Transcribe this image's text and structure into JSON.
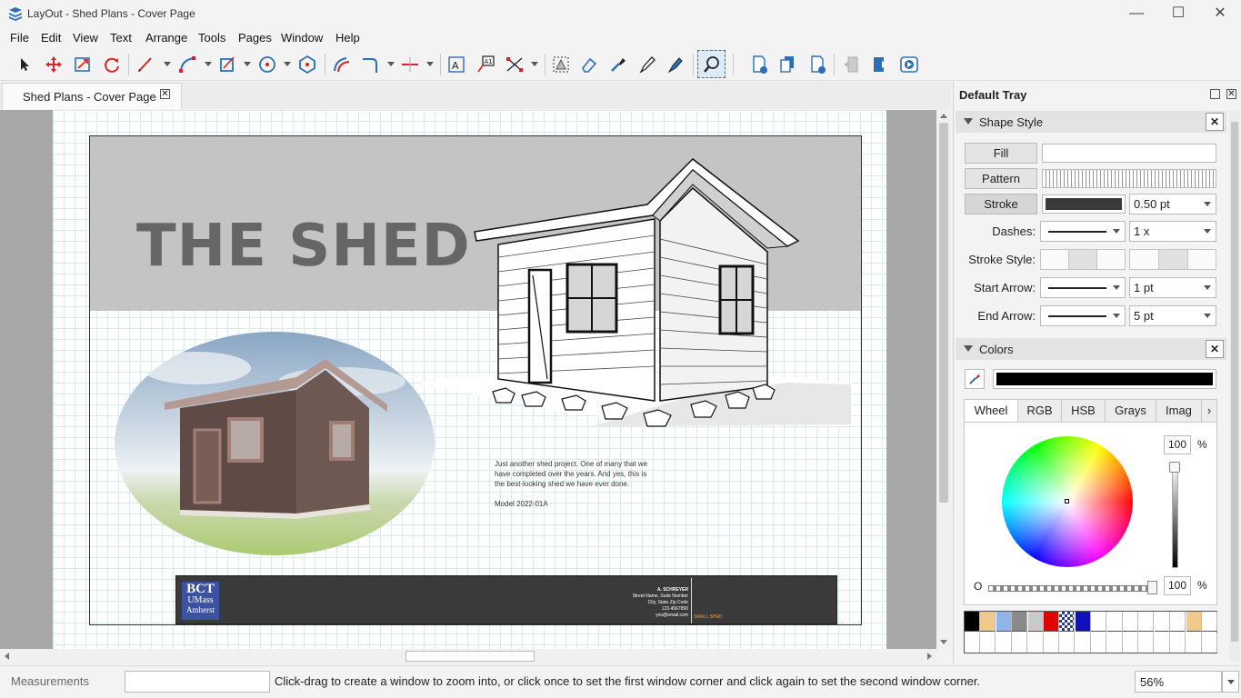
{
  "window": {
    "title": "LayOut - Shed Plans - Cover Page",
    "minimize": "—",
    "maximize": "☐",
    "close": "✕"
  },
  "menu": [
    "File",
    "Edit",
    "View",
    "Text",
    "Arrange",
    "Tools",
    "Pages",
    "Window",
    "Help"
  ],
  "doc_tab": {
    "label": "Shed Plans - Cover Page",
    "close": "✕"
  },
  "page": {
    "title": "THE SHED",
    "description_line1": "Just another shed project. One of many that we",
    "description_line2": "have completed over the years. And yes, this is",
    "description_line3": "the best-looking shed we have ever done.",
    "model": "Model 2022-01A",
    "titleblock": {
      "logo_top": "BCT",
      "logo_mid": "UMass",
      "logo_bot": "Amherst",
      "name": "A. SCHREYER",
      "line1": "Street Name, Suite Number",
      "line2": "City, State Zip Code",
      "line3": "123.4567890",
      "line4": "you@email.com",
      "project": "SMALL SHED"
    }
  },
  "tray": {
    "title": "Default Tray",
    "shape_style": {
      "header": "Shape Style",
      "fill": "Fill",
      "pattern": "Pattern",
      "stroke": "Stroke",
      "stroke_width": "0.50 pt",
      "dashes_label": "Dashes:",
      "dashes_scale": "1 x",
      "stroke_style_label": "Stroke Style:",
      "start_arrow_label": "Start Arrow:",
      "start_arrow_size": "1 pt",
      "end_arrow_label": "End Arrow:",
      "end_arrow_size": "5 pt"
    },
    "colors": {
      "header": "Colors",
      "tabs": [
        "Wheel",
        "RGB",
        "HSB",
        "Grays",
        "Imag"
      ],
      "brightness": "100",
      "opacity_label": "O",
      "opacity": "100",
      "pct": "%",
      "current_color": "#000000",
      "swatches": [
        "#000000",
        "#f0c98c",
        "#8fb4e8",
        "#8a8a8a",
        "#c9c9c9",
        "#e00000",
        "checker",
        "#1010c0",
        "#ffffff",
        "#ffffff",
        "#ffffff",
        "#ffffff",
        "#ffffff",
        "#ffffff",
        "#f0c98c",
        "#ffffff",
        "#ffffff"
      ]
    }
  },
  "status": {
    "measurements_label": "Measurements",
    "hint": "Click-drag to create a window to zoom into, or click once to set the first window corner and click again to set the second window corner.",
    "zoom": "56%"
  }
}
